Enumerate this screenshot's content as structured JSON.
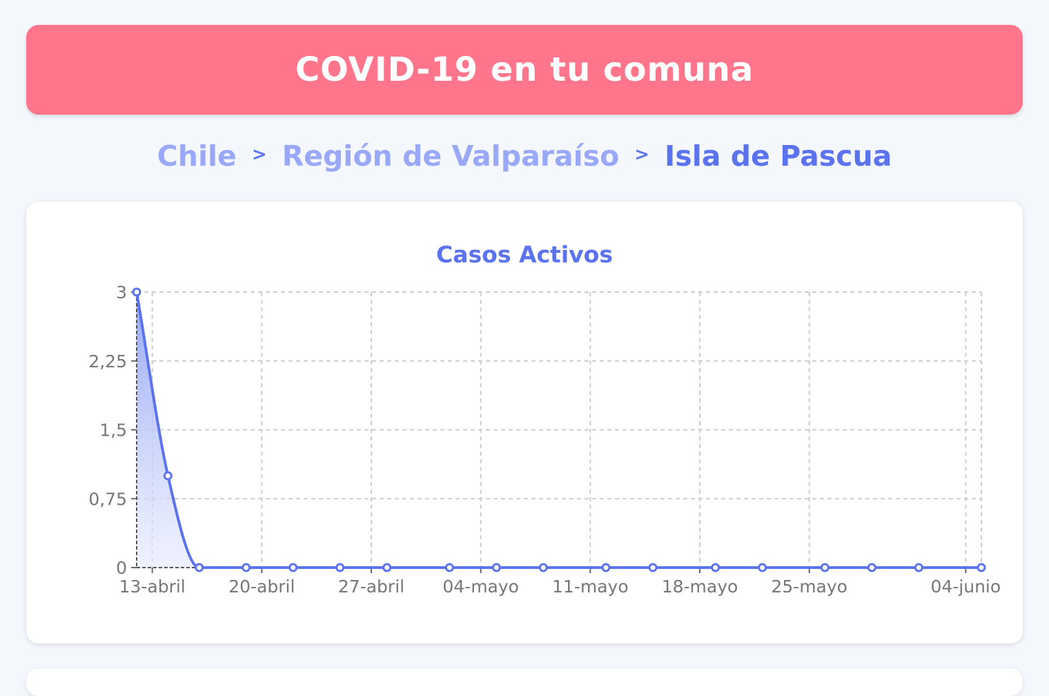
{
  "header": {
    "title": "COVID-19 en tu comuna"
  },
  "breadcrumb": {
    "items": [
      "Chile",
      "Región de Valparaíso",
      "Isla de Pascua"
    ],
    "separator": ">"
  },
  "colors": {
    "header_bg": "#ff768c",
    "accent": "#5b74ee",
    "crumb_link": "#99a9f7",
    "line": "#5b74ee",
    "grid": "#cccccc"
  },
  "chart_data": {
    "type": "area",
    "title": "Casos Activos",
    "xlabel": "",
    "ylabel": "",
    "x": [
      "2020-04-12",
      "2020-04-14",
      "2020-04-16",
      "2020-04-19",
      "2020-04-22",
      "2020-04-25",
      "2020-04-28",
      "2020-05-02",
      "2020-05-05",
      "2020-05-08",
      "2020-05-12",
      "2020-05-15",
      "2020-05-19",
      "2020-05-22",
      "2020-05-26",
      "2020-05-29",
      "2020-06-01",
      "2020-06-05"
    ],
    "series": [
      {
        "values": [
          3,
          1,
          0,
          0,
          0,
          0,
          0,
          0,
          0,
          0,
          0,
          0,
          0,
          0,
          0,
          0,
          0,
          0
        ]
      }
    ],
    "xlim": [
      "2020-04-12",
      "2020-06-05"
    ],
    "ylim": [
      0,
      3
    ],
    "y_ticks": [
      {
        "value": 0,
        "label": "0"
      },
      {
        "value": 0.75,
        "label": "0,75"
      },
      {
        "value": 1.5,
        "label": "1,5"
      },
      {
        "value": 2.25,
        "label": "2,25"
      },
      {
        "value": 3,
        "label": "3"
      }
    ],
    "x_ticks": [
      {
        "date": "2020-04-13",
        "label": "13-abril"
      },
      {
        "date": "2020-04-20",
        "label": "20-abril"
      },
      {
        "date": "2020-04-27",
        "label": "27-abril"
      },
      {
        "date": "2020-05-04",
        "label": "04-mayo"
      },
      {
        "date": "2020-05-11",
        "label": "11-mayo"
      },
      {
        "date": "2020-05-18",
        "label": "18-mayo"
      },
      {
        "date": "2020-05-25",
        "label": "25-mayo"
      },
      {
        "date": "2020-06-04",
        "label": "04-junio"
      }
    ],
    "grid": true,
    "legend": "none"
  }
}
